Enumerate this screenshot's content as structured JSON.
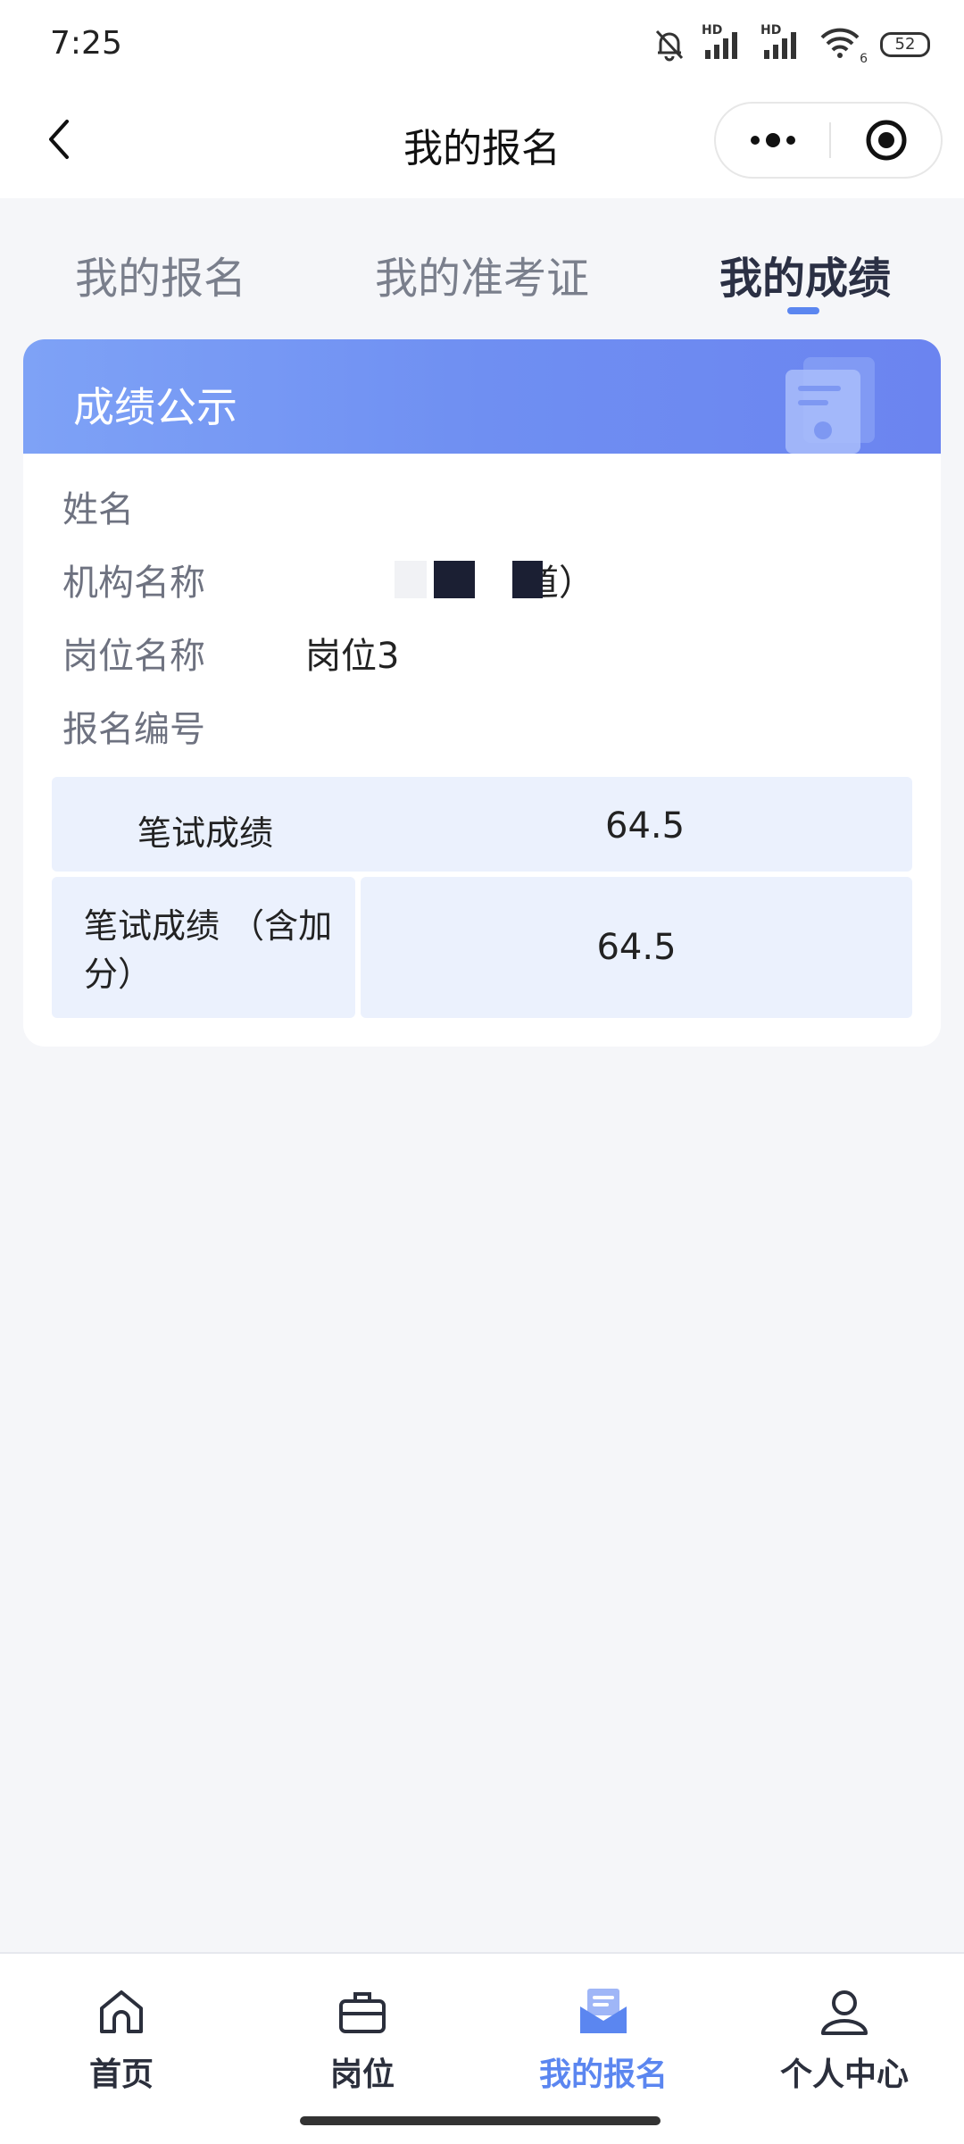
{
  "status_bar": {
    "time": "7:25",
    "network_label_1": "HD",
    "network_label_2": "HD",
    "wifi_badge": "6",
    "battery": "52"
  },
  "nav": {
    "title": "我的报名"
  },
  "tabs": [
    {
      "label": "我的报名",
      "active": false
    },
    {
      "label": "我的准考证",
      "active": false
    },
    {
      "label": "我的成绩",
      "active": true
    }
  ],
  "card": {
    "header_title": "成绩公示",
    "fields": [
      {
        "label": "姓名",
        "value": ""
      },
      {
        "label": "机构名称",
        "value": "道）"
      },
      {
        "label": "岗位名称",
        "value": "岗位3"
      },
      {
        "label": "报名编号",
        "value": ""
      }
    ],
    "scores": [
      {
        "label": "笔试成绩",
        "value": "64.5"
      },
      {
        "label": "笔试成绩 （含加分）",
        "value": "64.5"
      }
    ]
  },
  "bottom_nav": [
    {
      "label": "首页",
      "icon": "home-icon",
      "active": false
    },
    {
      "label": "岗位",
      "icon": "briefcase-icon",
      "active": false
    },
    {
      "label": "我的报名",
      "icon": "envelope-icon",
      "active": true
    },
    {
      "label": "个人中心",
      "icon": "user-icon",
      "active": false
    }
  ],
  "colors": {
    "accent": "#5b86f0",
    "header_gradient_start": "#7ea2f6",
    "header_gradient_end": "#6b84f0",
    "score_cell_bg": "#ebf1fd",
    "page_bg": "#f5f6f9"
  }
}
